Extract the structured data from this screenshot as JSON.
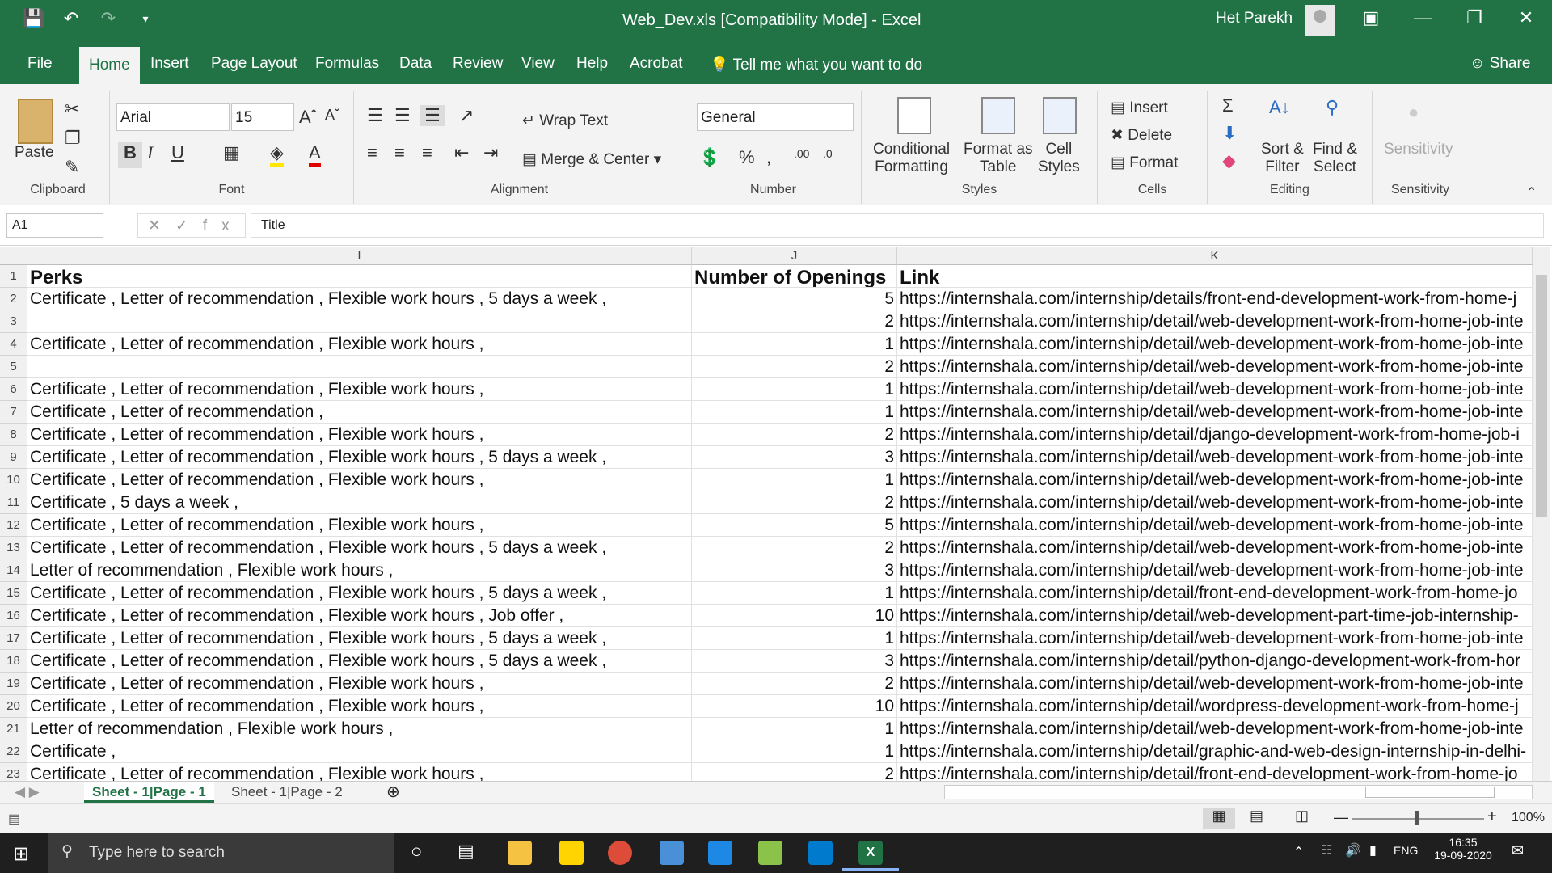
{
  "titlebar": {
    "title": "Web_Dev.xls  [Compatibility Mode]  -  Excel",
    "user": "Het Parekh"
  },
  "menu": {
    "tabs": [
      "File",
      "Home",
      "Insert",
      "Page Layout",
      "Formulas",
      "Data",
      "Review",
      "View",
      "Help",
      "Acrobat"
    ],
    "tell": "Tell me what you want to do",
    "share": "Share"
  },
  "ribbon": {
    "clipboard": {
      "label": "Clipboard",
      "paste": "Paste"
    },
    "font": {
      "label": "Font",
      "name": "Arial",
      "size": "15"
    },
    "alignment": {
      "label": "Alignment",
      "wrap": "Wrap Text",
      "merge": "Merge & Center"
    },
    "number": {
      "label": "Number",
      "format": "General"
    },
    "styles": {
      "label": "Styles",
      "cond": "Conditional",
      "cond2": "Formatting",
      "fmt": "Format as",
      "fmt2": "Table",
      "cell": "Cell",
      "cell2": "Styles"
    },
    "cells": {
      "label": "Cells",
      "insert": "Insert",
      "delete": "Delete",
      "format": "Format"
    },
    "editing": {
      "label": "Editing",
      "sort": "Sort &",
      "sort2": "Filter",
      "find": "Find &",
      "find2": "Select"
    },
    "sensitivity": {
      "label": "Sensitivity",
      "btn": "Sensitivity"
    }
  },
  "formula": {
    "namebox": "A1",
    "value": "Title"
  },
  "columns": [
    "I",
    "J",
    "K"
  ],
  "header": [
    "Perks",
    "Number of Openings",
    "Link"
  ],
  "rows": [
    {
      "r": "2",
      "perks": "Certificate , Letter of recommendation , Flexible work hours , 5 days a week ,",
      "n": "5",
      "link": "https://internshala.com/internship/details/front-end-development-work-from-home-j"
    },
    {
      "r": "3",
      "perks": "",
      "n": "2",
      "link": "https://internshala.com/internship/detail/web-development-work-from-home-job-inte"
    },
    {
      "r": "4",
      "perks": "Certificate , Letter of recommendation , Flexible work hours ,",
      "n": "1",
      "link": "https://internshala.com/internship/detail/web-development-work-from-home-job-inte"
    },
    {
      "r": "5",
      "perks": "",
      "n": "2",
      "link": "https://internshala.com/internship/detail/web-development-work-from-home-job-inte"
    },
    {
      "r": "6",
      "perks": "Certificate , Letter of recommendation , Flexible work hours ,",
      "n": "1",
      "link": "https://internshala.com/internship/detail/web-development-work-from-home-job-inte"
    },
    {
      "r": "7",
      "perks": "Certificate , Letter of recommendation ,",
      "n": "1",
      "link": "https://internshala.com/internship/detail/web-development-work-from-home-job-inte"
    },
    {
      "r": "8",
      "perks": "Certificate , Letter of recommendation , Flexible work hours ,",
      "n": "2",
      "link": "https://internshala.com/internship/detail/django-development-work-from-home-job-i"
    },
    {
      "r": "9",
      "perks": "Certificate , Letter of recommendation , Flexible work hours , 5 days a week ,",
      "n": "3",
      "link": "https://internshala.com/internship/detail/web-development-work-from-home-job-inte"
    },
    {
      "r": "10",
      "perks": "Certificate , Letter of recommendation , Flexible work hours ,",
      "n": "1",
      "link": "https://internshala.com/internship/detail/web-development-work-from-home-job-inte"
    },
    {
      "r": "11",
      "perks": "Certificate , 5 days a week ,",
      "n": "2",
      "link": "https://internshala.com/internship/detail/web-development-work-from-home-job-inte"
    },
    {
      "r": "12",
      "perks": "Certificate , Letter of recommendation , Flexible work hours ,",
      "n": "5",
      "link": "https://internshala.com/internship/detail/web-development-work-from-home-job-inte"
    },
    {
      "r": "13",
      "perks": "Certificate , Letter of recommendation , Flexible work hours , 5 days a week ,",
      "n": "2",
      "link": "https://internshala.com/internship/detail/web-development-work-from-home-job-inte"
    },
    {
      "r": "14",
      "perks": "Letter of recommendation , Flexible work hours ,",
      "n": "3",
      "link": "https://internshala.com/internship/detail/web-development-work-from-home-job-inte"
    },
    {
      "r": "15",
      "perks": "Certificate , Letter of recommendation , Flexible work hours , 5 days a week ,",
      "n": "1",
      "link": "https://internshala.com/internship/detail/front-end-development-work-from-home-jo"
    },
    {
      "r": "16",
      "perks": "Certificate , Letter of recommendation , Flexible work hours , Job offer ,",
      "n": "10",
      "link": "https://internshala.com/internship/detail/web-development-part-time-job-internship-"
    },
    {
      "r": "17",
      "perks": "Certificate , Letter of recommendation , Flexible work hours , 5 days a week ,",
      "n": "1",
      "link": "https://internshala.com/internship/detail/web-development-work-from-home-job-inte"
    },
    {
      "r": "18",
      "perks": "Certificate , Letter of recommendation , Flexible work hours , 5 days a week ,",
      "n": "3",
      "link": "https://internshala.com/internship/detail/python-django-development-work-from-hor"
    },
    {
      "r": "19",
      "perks": "Certificate , Letter of recommendation , Flexible work hours ,",
      "n": "2",
      "link": "https://internshala.com/internship/detail/web-development-work-from-home-job-inte"
    },
    {
      "r": "20",
      "perks": "Certificate , Letter of recommendation , Flexible work hours ,",
      "n": "10",
      "link": "https://internshala.com/internship/detail/wordpress-development-work-from-home-j"
    },
    {
      "r": "21",
      "perks": "Letter of recommendation , Flexible work hours ,",
      "n": "1",
      "link": "https://internshala.com/internship/detail/web-development-work-from-home-job-inte"
    },
    {
      "r": "22",
      "perks": "Certificate ,",
      "n": "1",
      "link": "https://internshala.com/internship/detail/graphic-and-web-design-internship-in-delhi-"
    },
    {
      "r": "23",
      "perks": "Certificate , Letter of recommendation , Flexible work hours ,",
      "n": "2",
      "link": "https://internshala.com/internship/detail/front-end-development-work-from-home-jo"
    }
  ],
  "sheets": [
    "Sheet - 1|Page - 1",
    "Sheet - 1|Page - 2"
  ],
  "status": {
    "zoom": "100%"
  },
  "taskbar": {
    "search": "Type here to search",
    "lang": "ENG",
    "time": "16:35",
    "date": "19-09-2020"
  }
}
